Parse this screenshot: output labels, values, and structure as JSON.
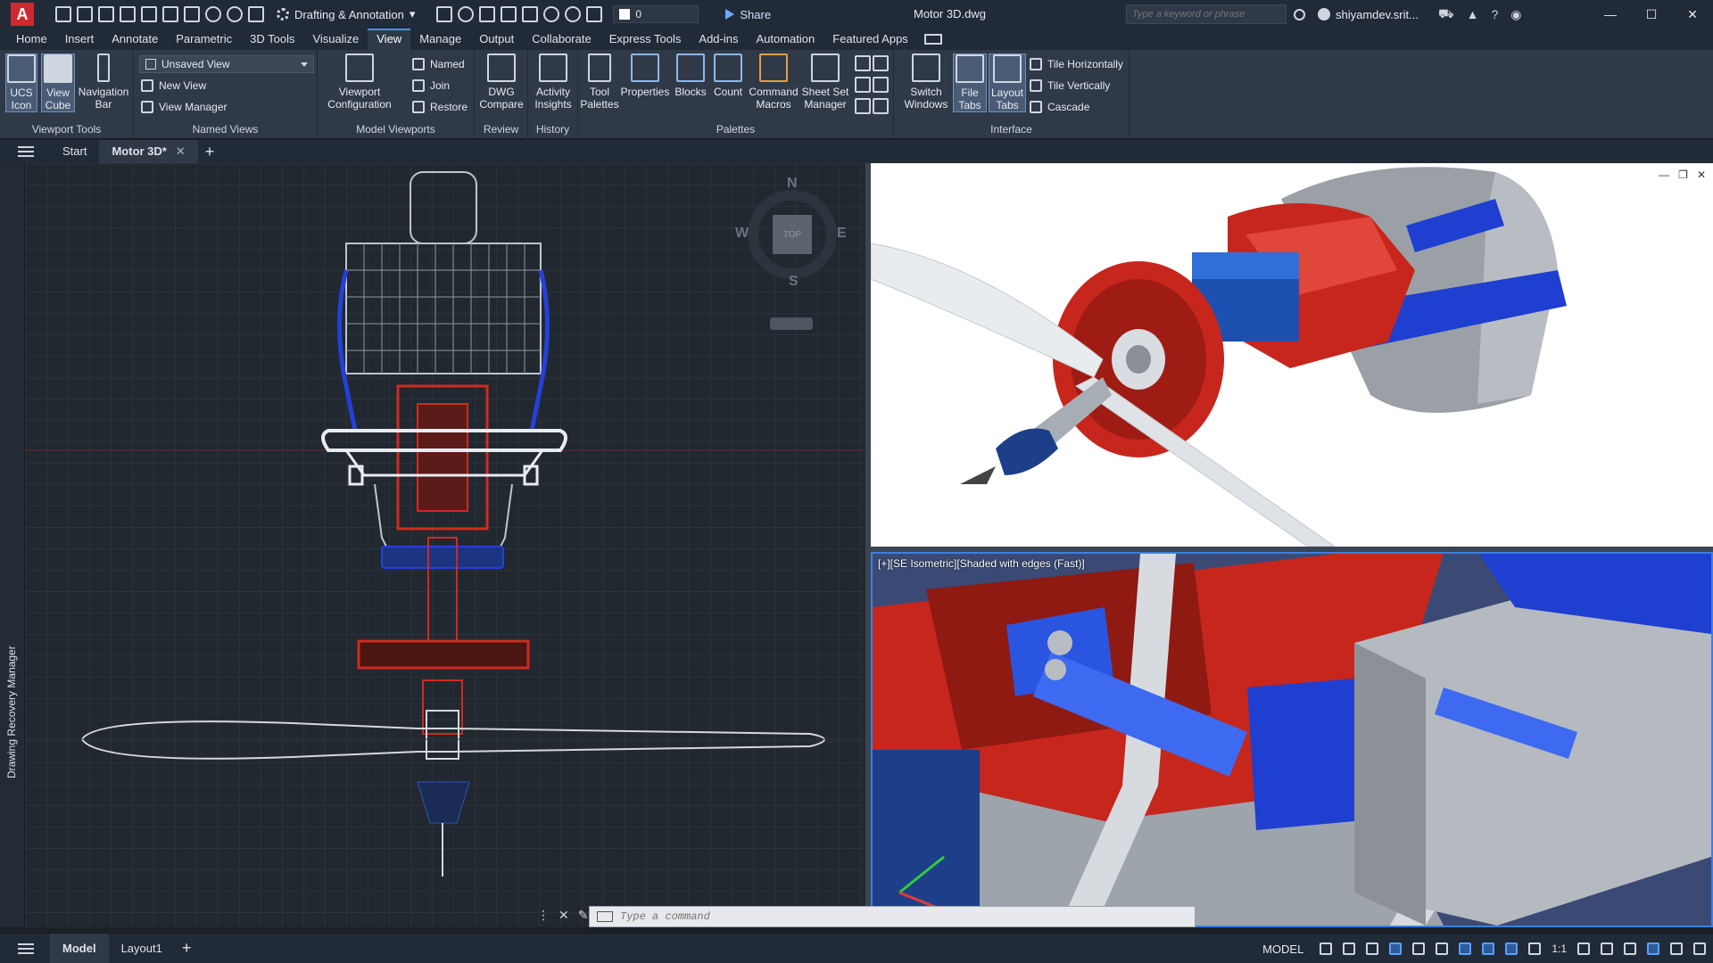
{
  "app": {
    "logo_letter": "A",
    "workspace": "Drafting & Annotation",
    "current_layer": "0",
    "share_label": "Share",
    "document_title": "Motor 3D.dwg",
    "search_placeholder": "Type a keyword or phrase",
    "user_name": "shiyamdev.srit..."
  },
  "ribbon_tabs": [
    "Home",
    "Insert",
    "Annotate",
    "Parametric",
    "3D Tools",
    "Visualize",
    "View",
    "Manage",
    "Output",
    "Collaborate",
    "Express Tools",
    "Add-ins",
    "Automation",
    "Featured Apps"
  ],
  "ribbon": {
    "viewport_tools": {
      "title": "Viewport Tools",
      "ucs_icon": [
        "UCS",
        "Icon"
      ],
      "view_cube": [
        "View",
        "Cube"
      ],
      "navigation_bar": [
        "Navigation",
        "Bar"
      ]
    },
    "named_views": {
      "title": "Named Views",
      "current_view": "Unsaved View",
      "new_view": "New View",
      "view_manager": "View Manager"
    },
    "model_viewports": {
      "title": "Model Viewports",
      "viewport_configuration": [
        "Viewport",
        "Configuration"
      ],
      "named": "Named",
      "join": "Join",
      "restore": "Restore"
    },
    "review": {
      "title": "Review",
      "dwg_compare": [
        "DWG",
        "Compare"
      ]
    },
    "history": {
      "title": "History",
      "activity_insights": [
        "Activity",
        "Insights"
      ]
    },
    "palettes": {
      "title": "Palettes",
      "tool_palettes": [
        "Tool",
        "Palettes"
      ],
      "properties": "Properties",
      "blocks": "Blocks",
      "count": "Count",
      "command_macros": [
        "Command",
        "Macros"
      ],
      "sheet_set_manager": [
        "Sheet Set",
        "Manager"
      ]
    },
    "interface": {
      "title": "Interface",
      "switch_windows": [
        "Switch",
        "Windows"
      ],
      "file_tabs": [
        "File",
        "Tabs"
      ],
      "layout_tabs": [
        "Layout",
        "Tabs"
      ],
      "tile_horizontally": "Tile Horizontally",
      "tile_vertically": "Tile Vertically",
      "cascade": "Cascade"
    }
  },
  "file_tabs": {
    "start": "Start",
    "active": "Motor 3D*"
  },
  "sidebar": {
    "label": "Drawing Recovery Manager"
  },
  "viewports": {
    "compass": {
      "n": "N",
      "s": "S",
      "e": "E",
      "w": "W",
      "face": "TOP"
    },
    "bottom_right_label": "[+][SE Isometric][Shaded with edges (Fast)]"
  },
  "command_line": {
    "placeholder": "Type a command"
  },
  "status_bar": {
    "tabs": [
      "Model",
      "Layout1"
    ],
    "model_space": "MODEL",
    "annotation_scale": "1:1"
  },
  "colors": {
    "accent": "#4a90e2",
    "ribbon_bg": "#2f3947",
    "titlebar_bg": "#212a37",
    "model_red": "#d0281f",
    "model_blue": "#1f3fd0"
  }
}
